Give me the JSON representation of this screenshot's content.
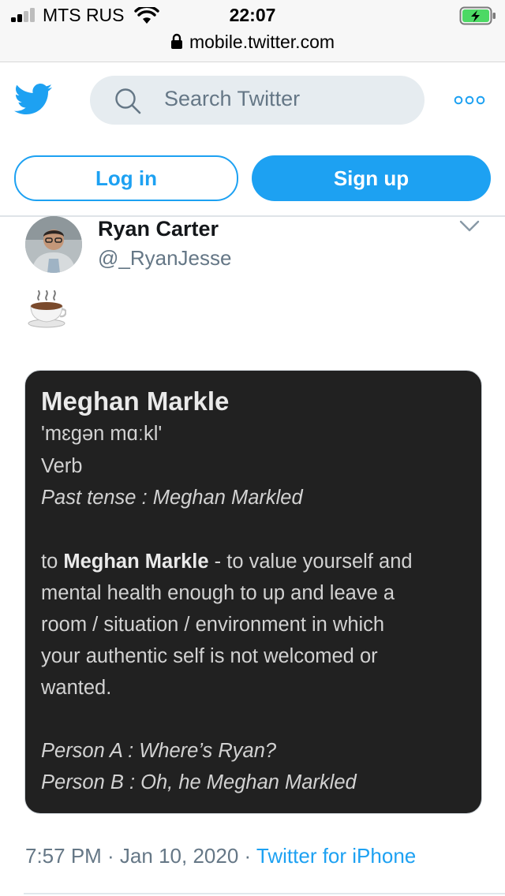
{
  "status_bar": {
    "carrier": "MTS RUS",
    "time": "22:07",
    "url": "mobile.twitter.com",
    "battery_color": "#4cd964"
  },
  "header": {
    "logo_icon": "twitter-bird-icon",
    "search_placeholder": "Search Twitter",
    "more_icon": "more-dots-icon",
    "login_label": "Log in",
    "signup_label": "Sign up",
    "brand_color": "#1da1f2"
  },
  "tweet": {
    "name": "Ryan Carter",
    "handle": "@_RyanJesse",
    "emoji": "☕",
    "card": {
      "title": "Meghan Markle",
      "pronunciation": "'mɛgən mɑːkl'",
      "part_of_speech": "Verb",
      "past_tense": "Past tense : Meghan Markled",
      "definition_prefix": "to ",
      "definition_bold": "Meghan Markle",
      "definition_line1_rest": " - to value yourself and",
      "definition_line2": "mental health enough to up and leave a",
      "definition_line3": "room / situation / environment in which",
      "definition_line4": "your authentic self is not welcomed or",
      "definition_line5": "wanted.",
      "example_a": "Person A : Where’s Ryan?",
      "example_b": "Person B :  Oh, he Meghan Markled"
    },
    "timestamp": "7:57 PM · Jan 10, 2020 · ",
    "source": "Twitter for iPhone"
  }
}
